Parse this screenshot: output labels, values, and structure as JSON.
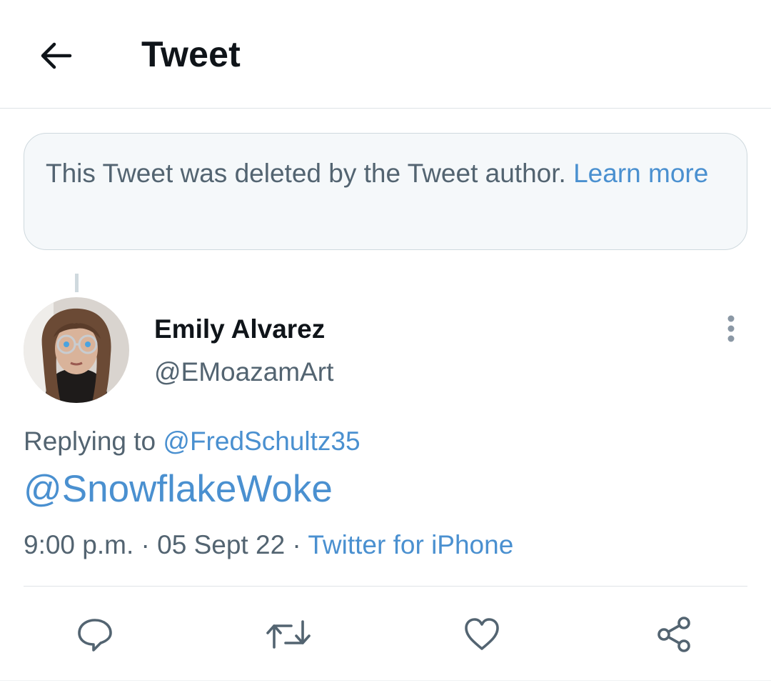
{
  "header": {
    "title": "Tweet",
    "back_icon": "arrow-left-icon"
  },
  "notice": {
    "text": "This Tweet was deleted by the Tweet author.",
    "link_label": "Learn more"
  },
  "tweet": {
    "author_name": "Emily Alvarez",
    "author_handle": "@EMoazamArt",
    "replying_prefix": "Replying to",
    "replying_to": "@FredSchultz35",
    "text": "@SnowflakeWoke",
    "time": "9:00 p.m.",
    "date": "05 Sept 22",
    "source": "Twitter for iPhone"
  },
  "actions": {
    "reply_icon": "comment-icon",
    "retweet_icon": "retweet-icon",
    "like_icon": "heart-icon",
    "share_icon": "share-icon"
  },
  "colors": {
    "link": "#4a90d0",
    "secondary_text": "#536471",
    "primary_text": "#0f1419",
    "notice_background": "#f5f8fa",
    "border": "#cfd9de"
  }
}
